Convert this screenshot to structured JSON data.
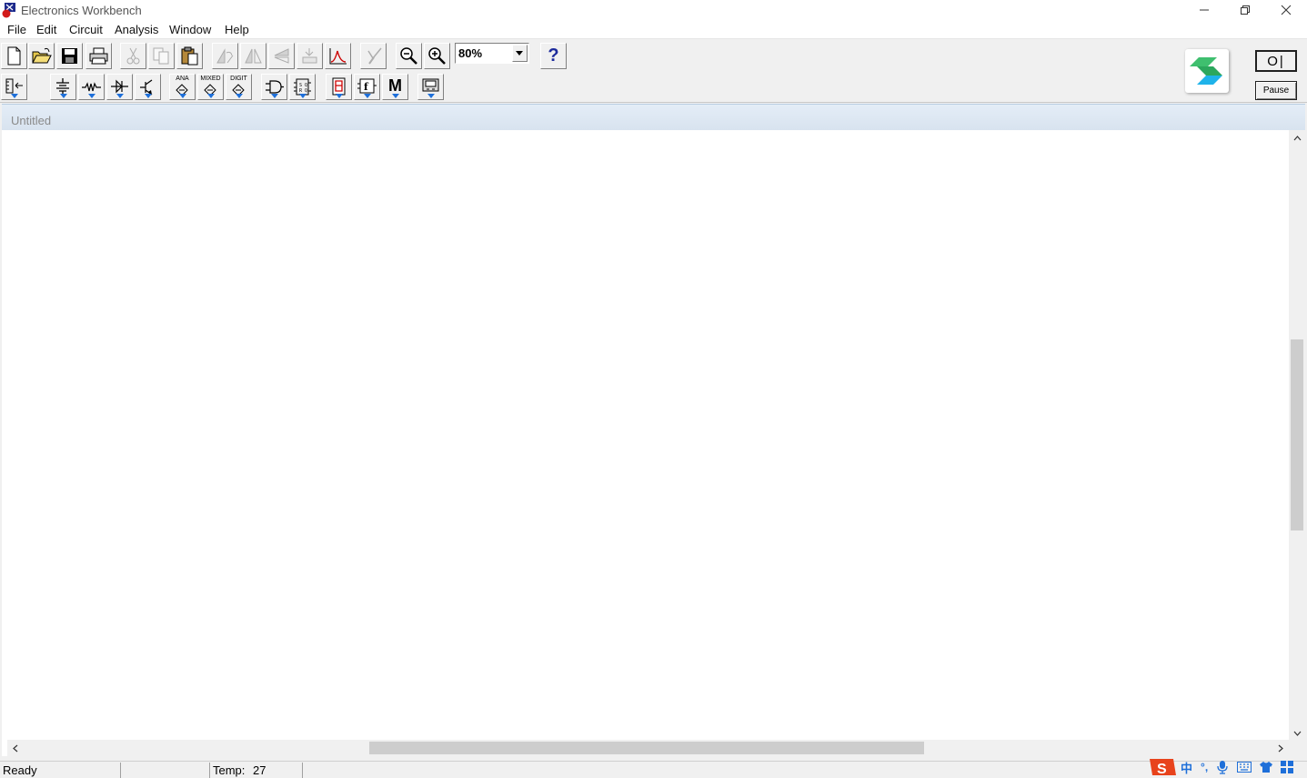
{
  "window": {
    "title": "Electronics Workbench"
  },
  "menu": [
    "File",
    "Edit",
    "Circuit",
    "Analysis",
    "Window",
    "Help"
  ],
  "toolbar": {
    "zoom_value": "80%",
    "help_label": "?",
    "pause_label": "Pause",
    "power_label": "O|",
    "ana_label": "ANA",
    "mixed_label": "MIXED",
    "digit_label": "DIGIT",
    "misc_label": "M"
  },
  "document": {
    "title": "Untitled"
  },
  "status": {
    "ready": "Ready",
    "temp_label": "Temp:",
    "temp_value": "27"
  },
  "tray": {
    "ime_label": "中",
    "punct_label": "°,"
  },
  "colors": {
    "accent_blue": "#1e6fd9",
    "logo_green": "#3fbf6f",
    "logo_cyan": "#1fb3ea",
    "ime_red": "#e8431c"
  }
}
